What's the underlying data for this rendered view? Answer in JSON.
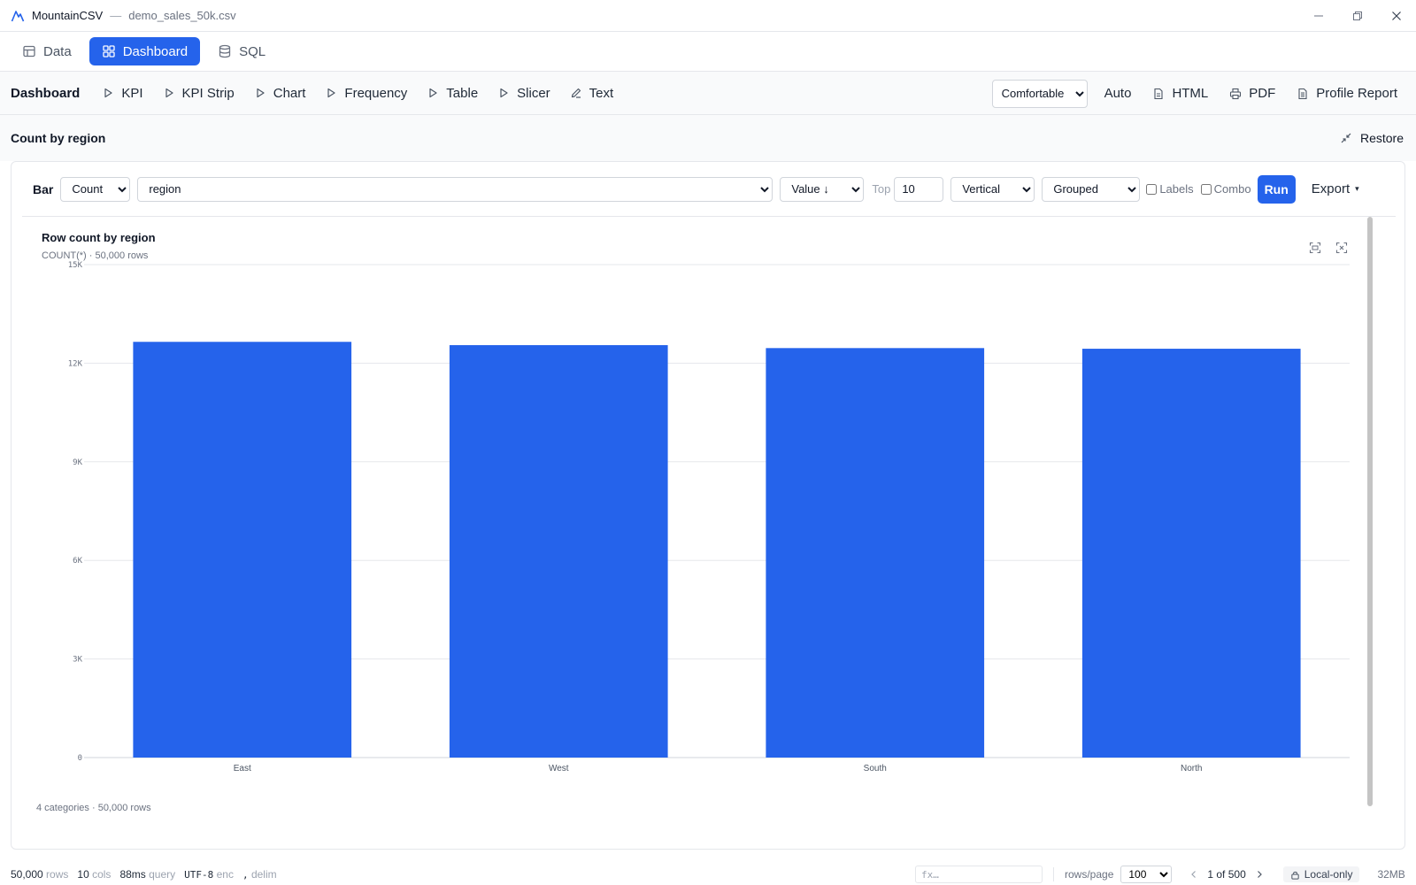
{
  "titlebar": {
    "app_name": "MountainCSV",
    "separator": "—",
    "file_name": "demo_sales_50k.csv"
  },
  "tabs": [
    {
      "label": "Data",
      "icon": "table-icon",
      "active": false
    },
    {
      "label": "Dashboard",
      "icon": "dashboard-icon",
      "active": true
    },
    {
      "label": "SQL",
      "icon": "database-icon",
      "active": false
    }
  ],
  "toolbar": {
    "title": "Dashboard",
    "items": [
      "KPI",
      "KPI Strip",
      "Chart",
      "Frequency",
      "Table",
      "Slicer",
      "Text"
    ],
    "density_value": "Comfortable",
    "density_options": [
      "Comfortable"
    ],
    "auto_label": "Auto",
    "html_label": "HTML",
    "pdf_label": "PDF",
    "profile_label": "Profile Report"
  },
  "panel": {
    "title": "Count by region",
    "restore_label": "Restore"
  },
  "controls": {
    "type_label": "Bar",
    "aggregate": "Count",
    "column": "region",
    "sort": "Value ↓",
    "top_label": "Top",
    "top_value": "10",
    "orientation": "Vertical",
    "mode": "Grouped",
    "labels_label": "Labels",
    "combo_label": "Combo",
    "run_label": "Run",
    "export_label": "Export",
    "export_caret": "▾"
  },
  "chart_data": {
    "type": "bar",
    "title": "Row count by region",
    "subtitle": "COUNT(*) · 50,000 rows",
    "categories": [
      "East",
      "West",
      "South",
      "North"
    ],
    "values": [
      12650,
      12550,
      12460,
      12440
    ],
    "ylim": [
      0,
      15000
    ],
    "yticks": [
      0,
      3000,
      6000,
      9000,
      12000,
      15000
    ],
    "ytick_labels": [
      "0",
      "3K",
      "6K",
      "9K",
      "12K",
      "15K"
    ],
    "grid": true,
    "color": "#2563eb",
    "footer": "4 categories · 50,000 rows"
  },
  "status": {
    "rows_value": "50,000",
    "rows_label": "rows",
    "cols_value": "10",
    "cols_label": "cols",
    "query_value": "88ms",
    "query_label": "query",
    "enc_value": "UTF-8",
    "enc_label": "enc",
    "delim_value": ",",
    "delim_label": "delim",
    "fx_placeholder": "fx…",
    "rows_page_label": "rows/page",
    "rows_page_value": "100",
    "page_text": "1 of 500",
    "local_label": "Local-only",
    "memory": "32MB"
  },
  "colors": {
    "accent": "#2563eb"
  }
}
